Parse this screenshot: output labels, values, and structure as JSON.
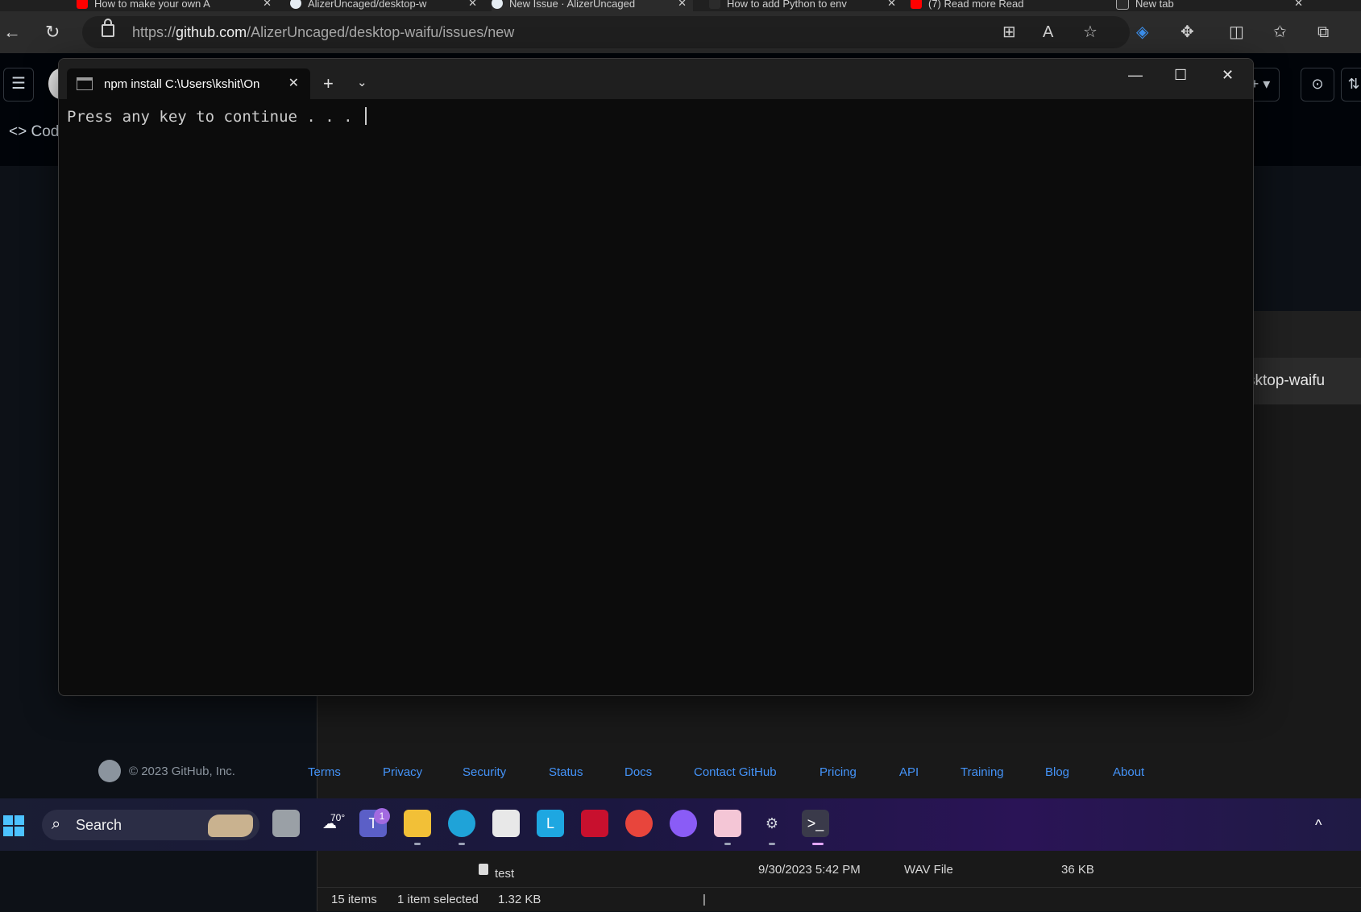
{
  "browser": {
    "tabs": [
      {
        "label": "How to make your own A",
        "color": "#ff0000"
      },
      {
        "label": "AlizerUncaged/desktop-w",
        "color": "#e6edf3"
      },
      {
        "label": "New Issue · AlizerUncaged",
        "color": "#e6edf3"
      },
      {
        "label": "How to add Python to env",
        "color": "#2b2b2b"
      },
      {
        "label": "(7) Read more Read",
        "color": "#ff0000"
      },
      {
        "label": "New tab",
        "color": "#2b2b2b"
      }
    ],
    "tab_close": "✕",
    "url_domain": "github.com",
    "url_prefix": "https://",
    "url_path": "/AlizerUncaged/desktop-waifu/issues/new",
    "icons": [
      "back-icon",
      "refresh-icon",
      "lock-icon",
      "apps-icon",
      "read-aloud-icon",
      "favorite-icon",
      "shield-icon",
      "extensions-icon",
      "split-screen-icon",
      "favorites-icon",
      "collections-icon"
    ]
  },
  "github": {
    "menu_glyph": "☰",
    "code_label": "Cod",
    "code_glyph": "<>",
    "plus_glyph": "+ ▾",
    "issues_glyph": "⊙",
    "pr_glyph": "⇅",
    "footer": {
      "copyright": "© 2023 GitHub, Inc.",
      "links": [
        "Terms",
        "Privacy",
        "Security",
        "Status",
        "Docs",
        "Contact GitHub",
        "Pricing",
        "API",
        "Training",
        "Blog",
        "About"
      ]
    }
  },
  "explorer": {
    "path_fragment": "sktop-waifu",
    "minimize": "—",
    "file": {
      "name": "test",
      "date": "9/30/2023 5:42 PM",
      "type": "WAV File",
      "size": "36 KB"
    },
    "status": {
      "items": "15 items",
      "selected": "1 item selected",
      "selected_size": "1.32 KB",
      "sep": "|"
    }
  },
  "terminal": {
    "tab_title": "npm install C:\\Users\\kshit\\On",
    "tab_close": "✕",
    "new_tab": "+",
    "dropdown": "⌄",
    "minimize": "—",
    "maximize": "☐",
    "close": "✕",
    "output": "Press any key to continue . . . "
  },
  "taskbar": {
    "search_label": "Search",
    "search_glyph": "⌕",
    "weather_temp": "70°",
    "teams_badge": "1",
    "tray_chevron": "^",
    "apps": [
      "task-view",
      "weather",
      "teams",
      "file-explorer",
      "edge",
      "store",
      "launcher",
      "mcafee",
      "chrome",
      "messenger",
      "photos",
      "settings",
      "terminal"
    ]
  }
}
